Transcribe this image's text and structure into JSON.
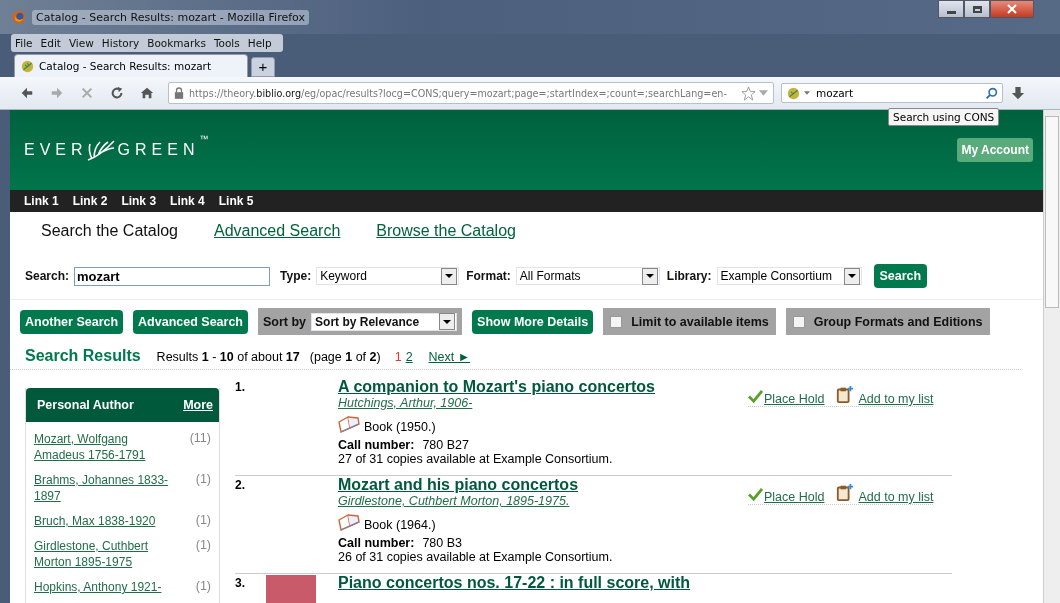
{
  "window": {
    "title": "Catalog - Search Results: mozart - Mozilla Firefox"
  },
  "menu": [
    "File",
    "Edit",
    "View",
    "History",
    "Bookmarks",
    "Tools",
    "Help"
  ],
  "tabs": [
    {
      "label": "Catalog - Search Results: mozart",
      "selected": true
    }
  ],
  "new_tab": "+",
  "address_bar": {
    "url": "https://theory.**biblio.org**/eg/opac/results?locg=CONS;query=mozart;page=;startIndex=;count=;searchLang=en-"
  },
  "browser_search": {
    "value": "mozart",
    "tooltip": "Search using CONS"
  },
  "header": {
    "logo_left": "EVER",
    "logo_right": "GREEN",
    "logo_mark": "™",
    "account_button": "My Account"
  },
  "links": [
    "Link 1",
    "Link 2",
    "Link 3",
    "Link 4",
    "Link 5"
  ],
  "search_tabs": [
    {
      "label": "Search the Catalog",
      "selected": true
    },
    {
      "label": "Advanced Search",
      "selected": false
    },
    {
      "label": "Browse the Catalog",
      "selected": false
    }
  ],
  "search_form": {
    "search_label": "Search:",
    "search_value": "mozart",
    "type_label": "Type:",
    "type_value": "Keyword",
    "format_label": "Format:",
    "format_value": "All Formats",
    "library_label": "Library:",
    "library_value": "Example Consortium",
    "search_button": "Search"
  },
  "toolbar": {
    "another_search": "Another Search",
    "advanced_search": "Advanced Search",
    "sort_label": "Sort by",
    "sort_value": "Sort by Relevance",
    "more_details": "Show More Details",
    "filters": [
      {
        "label": "Limit to available items",
        "checked": false
      },
      {
        "label": "Group Formats and Editions",
        "checked": false
      }
    ]
  },
  "results_header": {
    "title": "Search Results",
    "summary": "Results **1** - **10** of about **17**",
    "page_info": "(page **1** of **2**)",
    "pages": [
      {
        "label": "1",
        "selected": true
      },
      {
        "label": "2",
        "selected": false
      }
    ],
    "next": "Next ►"
  },
  "facet": {
    "title": "Personal Author",
    "more": "More",
    "items": [
      {
        "name": "Mozart, Wolfgang Amadeus 1756-1791",
        "count": "(11)"
      },
      {
        "name": "Brahms, Johannes 1833-1897",
        "count": "(1)"
      },
      {
        "name": "Bruch, Max 1838-1920",
        "count": "(1)"
      },
      {
        "name": "Girdlestone, Cuthbert Morton 1895-1975",
        "count": "(1)"
      },
      {
        "name": "Hopkins, Anthony 1921-",
        "count": "(1)"
      }
    ]
  },
  "results": [
    {
      "number": "1.",
      "title": "A companion to Mozart's piano concertos",
      "author": "Hutchings, Arthur, 1906-",
      "format": "Book (1950.)",
      "call_label": "Call number:",
      "call_number": "780 B27",
      "copies": "27 of 31 copies available at Example Consortium.",
      "cover": false,
      "place_hold": "Place Hold",
      "add_to_list": "Add to my list"
    },
    {
      "number": "2.",
      "title": "Mozart and his piano concertos",
      "author": "Girdlestone, Cuthbert Morton, 1895-1975.",
      "format": "Book (1964.)",
      "call_label": "Call number:",
      "call_number": "780 B3",
      "copies": "26 of 31 copies available at Example Consortium.",
      "cover": false,
      "place_hold": "Place Hold",
      "add_to_list": "Add to my list"
    },
    {
      "number": "3.",
      "title": "Piano concertos nos. 17-22 : in full score, with",
      "cover": true
    }
  ]
}
